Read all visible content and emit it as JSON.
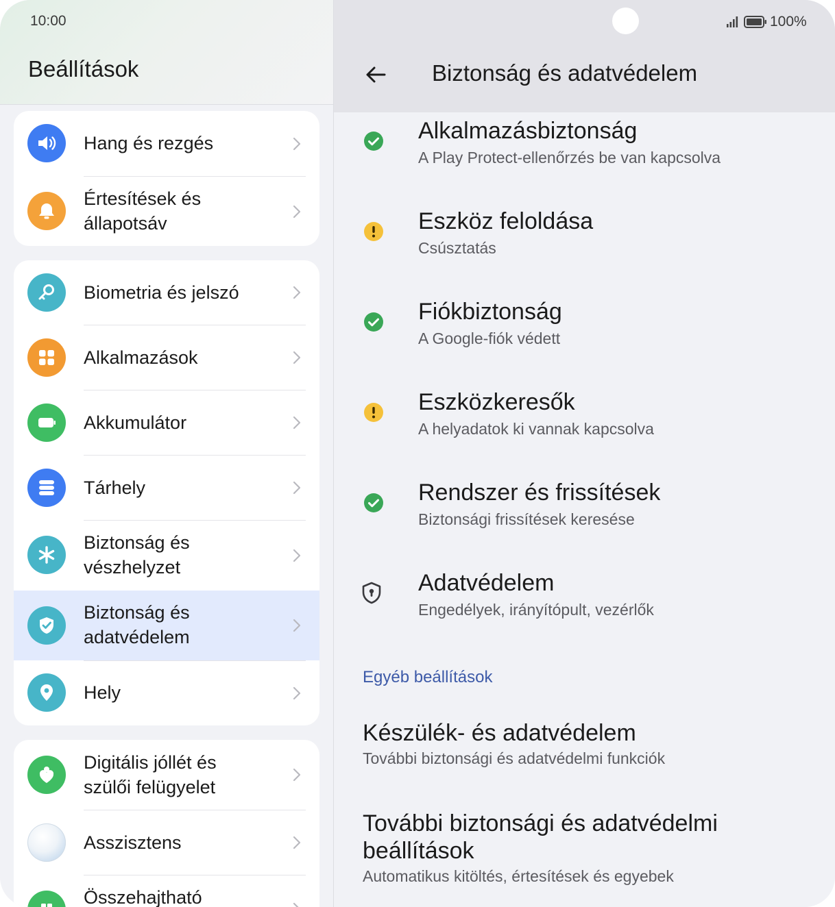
{
  "status": {
    "time": "10:00",
    "battery": "100%"
  },
  "left": {
    "title": "Beállítások",
    "groups": [
      {
        "items": [
          {
            "label": "Hang és rezgés",
            "icon": "speaker-icon",
            "color": "#3f7cf2"
          },
          {
            "label": "Értesítések és állapotsáv",
            "icon": "bell-icon",
            "color": "#f4a23a"
          }
        ]
      },
      {
        "items": [
          {
            "label": "Biometria és jelszó",
            "icon": "key-icon",
            "color": "#47b5c8"
          },
          {
            "label": "Alkalmazások",
            "icon": "apps-icon",
            "color": "#f29a32"
          },
          {
            "label": "Akkumulátor",
            "icon": "battery-icon",
            "color": "#3fbd63"
          },
          {
            "label": "Tárhely",
            "icon": "storage-icon",
            "color": "#3f7cf2"
          },
          {
            "label": "Biztonság és vészhelyzet",
            "icon": "asterisk-icon",
            "color": "#47b5c8"
          },
          {
            "label": "Biztonság és adatvédelem",
            "icon": "shield-check-icon",
            "color": "#47b5c8",
            "selected": true
          },
          {
            "label": "Hely",
            "icon": "location-pin-icon",
            "color": "#47b5c8"
          }
        ]
      },
      {
        "items": [
          {
            "label": "Digitális jóllét és szülői felügyelet",
            "icon": "heart-person-icon",
            "color": "#3fbd63"
          },
          {
            "label": "Asszisztens",
            "icon": "assistant-orb-icon",
            "color": "#d9e6f3"
          },
          {
            "label": "Összehajtható",
            "icon": "foldable-icon",
            "color": "#3fbd63"
          }
        ]
      }
    ]
  },
  "right": {
    "title": "Biztonság és adatvédelem",
    "items": [
      {
        "title": "Alkalmazásbiztonság",
        "subtitle": "A Play Protect-ellenőrzés be van kapcsolva",
        "status": "ok",
        "ok_color": "#3aa757"
      },
      {
        "title": "Eszköz feloldása",
        "subtitle": "Csúsztatás",
        "status": "warning",
        "warn_color": "#f5c13a"
      },
      {
        "title": "Fiókbiztonság",
        "subtitle": "A Google-fiók védett",
        "status": "ok"
      },
      {
        "title": "Eszközkeresők",
        "subtitle": "A helyadatok ki vannak kapcsolva",
        "status": "warning"
      },
      {
        "title": "Rendszer és frissítések",
        "subtitle": "Biztonsági frissítések keresése",
        "status": "ok"
      },
      {
        "title": "Adatvédelem",
        "subtitle": "Engedélyek, irányítópult, vezérlők",
        "status": "privacy"
      }
    ],
    "section_label": "Egyéb beállítások",
    "other": [
      {
        "title": "Készülék- és adatvédelem",
        "subtitle": "További biztonsági és adatvédelmi funkciók"
      },
      {
        "title": "További biztonsági és adatvédelmi beállítások",
        "subtitle": "Automatikus kitöltés, értesítések és egyebek"
      }
    ]
  }
}
